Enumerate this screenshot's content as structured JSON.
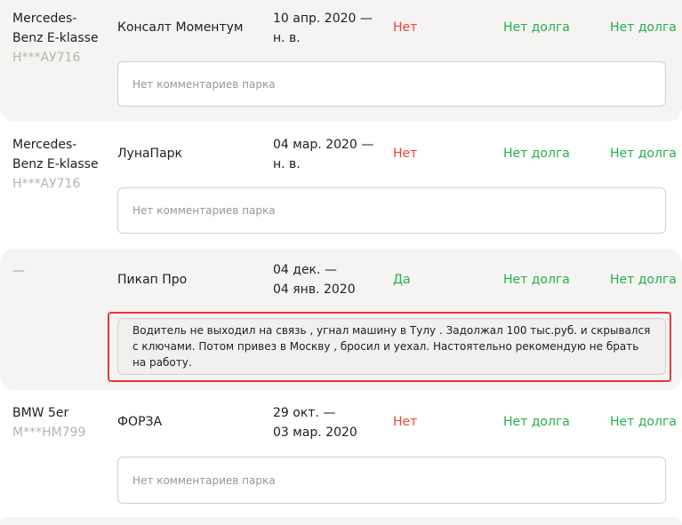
{
  "rows": [
    {
      "car_model": "Mercedes-\nBenz E-klasse",
      "car_plate": "Н***АУ716",
      "park": "Консалт Моментум",
      "period": "10 апр. 2020 —\nн. в.",
      "debt_flag": "Нет",
      "debt_a": "Нет долга",
      "debt_b": "Нет долга",
      "comment": "Нет комментариев парка"
    },
    {
      "car_model": "Mercedes-\nBenz E-klasse",
      "car_plate": "Н***АУ716",
      "park": "ЛунаПарк",
      "period": "04 мар. 2020 —\nн. в.",
      "debt_flag": "Нет",
      "debt_a": "Нет долга",
      "debt_b": "Нет долга",
      "comment": "Нет комментариев парка"
    },
    {
      "car_model": "—",
      "car_plate": "",
      "park": "Пикап Про",
      "period": "04 дек. —\n04 янв. 2020",
      "debt_flag": "Да",
      "debt_a": "Нет долга",
      "debt_b": "Нет долга",
      "comment": "Водитель не выходил на связь , угнал машину в Тулу . Задолжал 100 тыс.руб. и скрывался с ключами. Потом привез в Москву , бросил и уехал. Настоятельно рекомендую не брать на работу."
    },
    {
      "car_model": "BMW 5er",
      "car_plate": "М***НМ799",
      "park": "ФОРЗА",
      "period": "29 окт. —\n03 мар. 2020",
      "debt_flag": "Нет",
      "debt_a": "Нет долга",
      "debt_b": "Нет долга",
      "comment": "Нет комментариев парка"
    }
  ],
  "colors": {
    "row_shade": "#f5f4f2",
    "debt_yes": "#f0413a",
    "debt_no": "#22b04a",
    "plate": "#b7b4b0",
    "highlight": "#e53935"
  }
}
